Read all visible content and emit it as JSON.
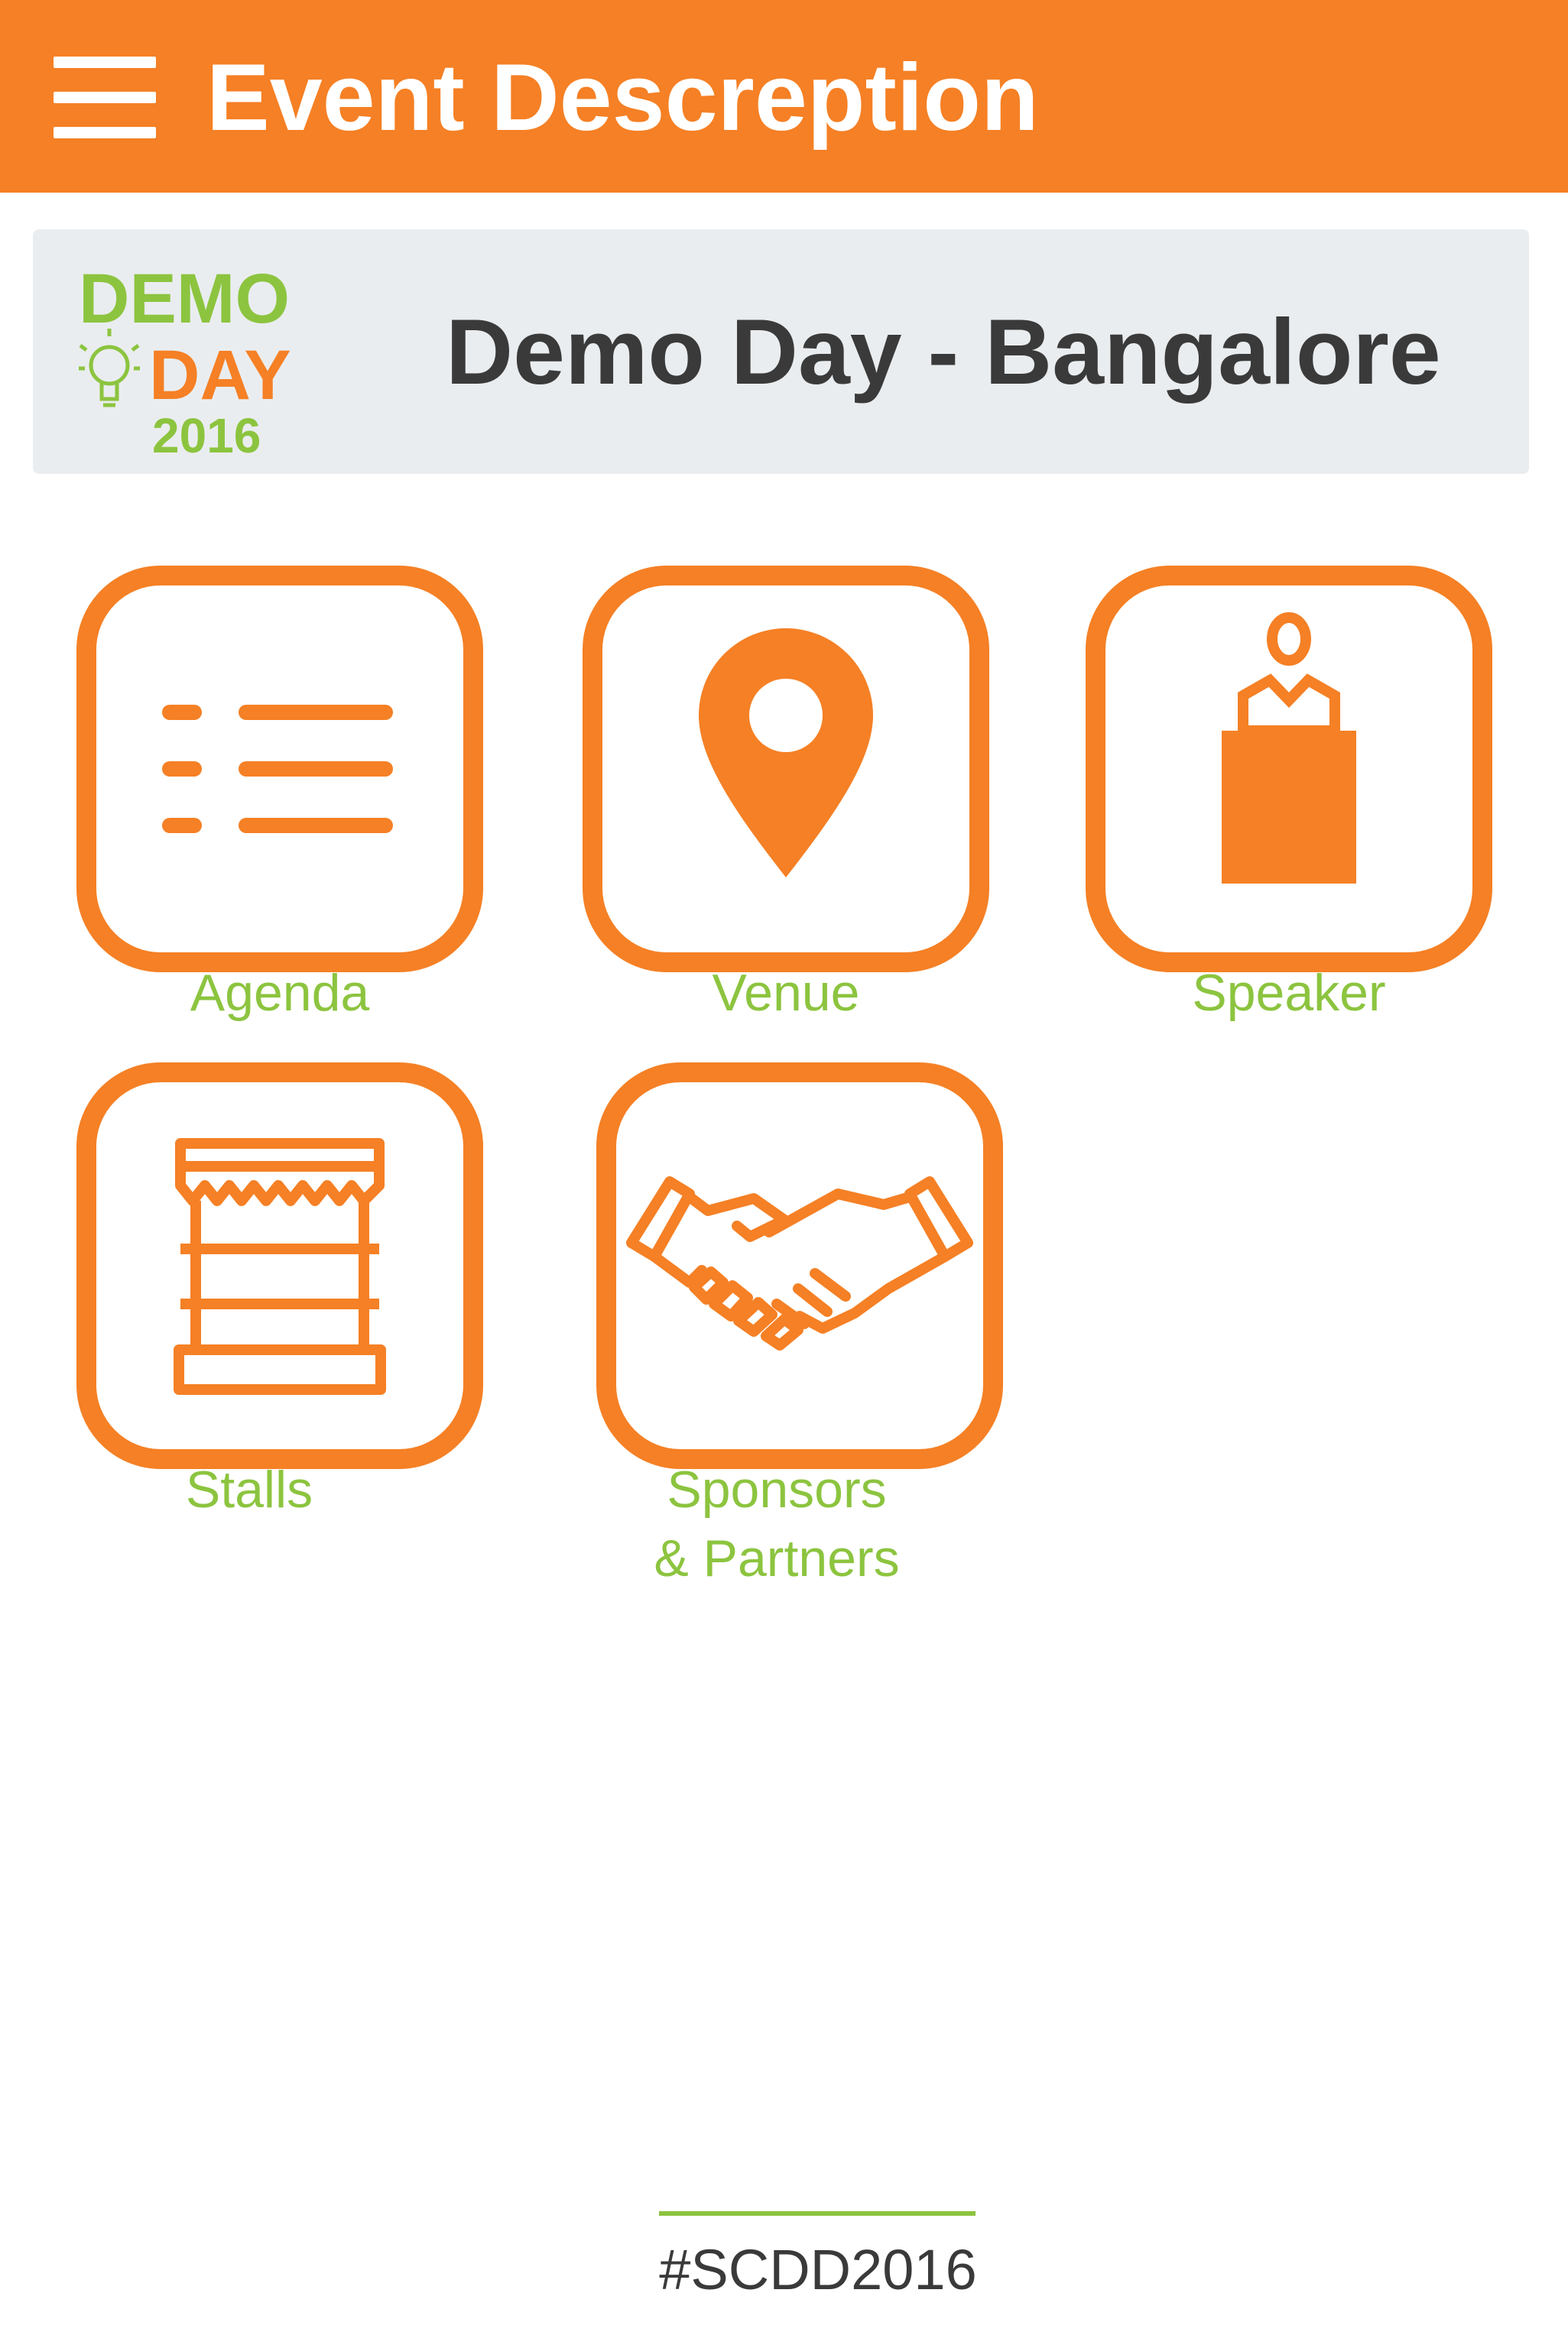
{
  "appbar": {
    "title": "Event Descreption",
    "menu_icon": "hamburger-menu-icon",
    "background": "#f58025"
  },
  "event": {
    "name": "Demo Day - Bangalore",
    "logo": {
      "line1": "DEMO",
      "line2": "DAY",
      "year": "2016"
    }
  },
  "tiles": [
    {
      "label": "Agenda",
      "icon": "list-icon"
    },
    {
      "label": "Venue",
      "icon": "map-pin-icon"
    },
    {
      "label": "Speaker",
      "icon": "podium-speaker-icon"
    },
    {
      "label": "Stalls",
      "icon": "market-stall-icon"
    },
    {
      "label": "Sponsors",
      "label_line2": "& Partners",
      "icon": "handshake-icon"
    }
  ],
  "footer": {
    "hashtag": "#SCDD2016"
  },
  "colors": {
    "accent_orange": "#f58025",
    "label_green": "#8cc43f",
    "card_bg": "#eaedef",
    "dark_text": "#3a3a3a"
  }
}
